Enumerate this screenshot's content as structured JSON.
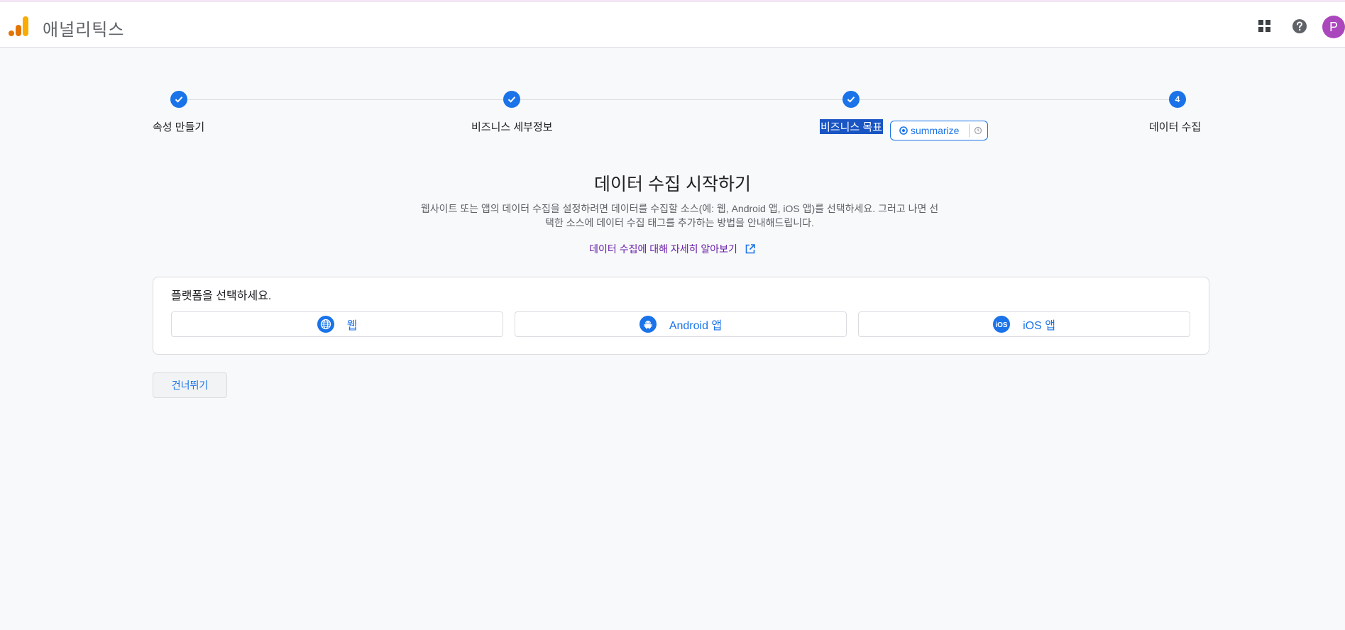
{
  "header": {
    "app_title": "애널리틱스",
    "avatar_initial": "P"
  },
  "stepper": {
    "steps": [
      {
        "label": "속성 만들기",
        "state": "done"
      },
      {
        "label": "비즈니스 세부정보",
        "state": "done"
      },
      {
        "label": "비즈니스 목표",
        "state": "done"
      },
      {
        "label": "데이터 수집",
        "state": "current",
        "number": "4"
      }
    ],
    "summarize_label": "summarize"
  },
  "main": {
    "title": "데이터 수집 시작하기",
    "description_line1": "웹사이트 또는 앱의 데이터 수집을 설정하려면 데이터를 수집할 소스(예: 웹, Android 앱, iOS 앱)를 선택하세요. 그러고 나면 선",
    "description_line2": "택한 소스에 데이터 수집 태그를 추가하는 방법을 안내해드립니다.",
    "learn_more_link": "데이터 수집에 대해 자세히 알아보기"
  },
  "platform": {
    "title": "플랫폼을 선택하세요.",
    "buttons": [
      {
        "label": "웹",
        "icon": "globe-icon"
      },
      {
        "label": "Android 앱",
        "icon": "android-icon"
      },
      {
        "label": "iOS 앱",
        "icon": "ios-icon"
      }
    ]
  },
  "actions": {
    "skip_label": "건너뛰기"
  },
  "colors": {
    "primary": "#1a73e8",
    "avatar": "#ab47bc",
    "link_visited": "#681da8",
    "logo_orange": "#f9ab00",
    "logo_dark_orange": "#e37400"
  }
}
